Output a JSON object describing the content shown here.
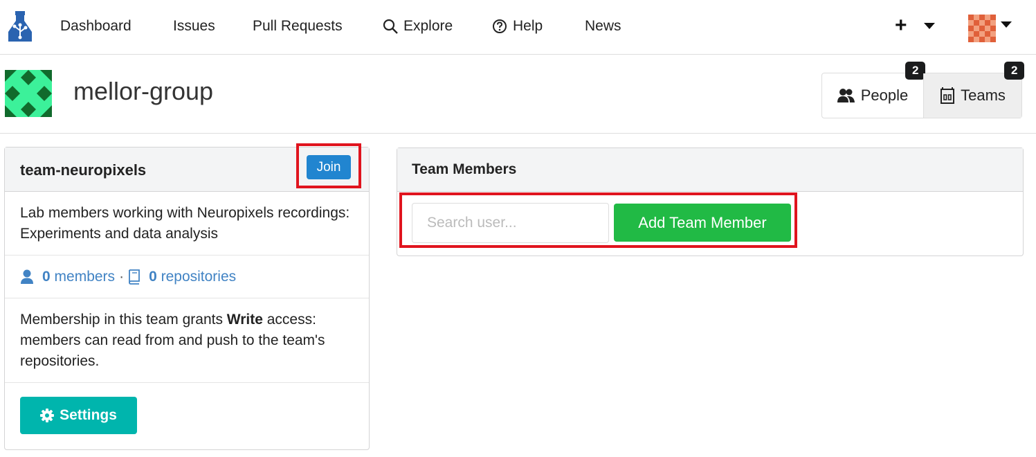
{
  "nav": {
    "items": [
      {
        "label": "Dashboard"
      },
      {
        "label": "Issues"
      },
      {
        "label": "Pull Requests"
      },
      {
        "label": "Explore",
        "icon": "search-icon"
      },
      {
        "label": "Help",
        "icon": "help-circle-icon"
      },
      {
        "label": "News"
      }
    ],
    "plus_label": "+"
  },
  "org": {
    "name": "mellor-group",
    "tabs": {
      "people": {
        "label": "People",
        "count": "2"
      },
      "teams": {
        "label": "Teams",
        "count": "2"
      }
    }
  },
  "team": {
    "name": "team-neuropixels",
    "join_label": "Join",
    "description": "Lab members working with Neuropixels recordings: Experiments and data analysis",
    "members_count": "0",
    "members_label": "members",
    "separator": "·",
    "repos_count": "0",
    "repos_label": "repositories",
    "permission": {
      "prefix": "Membership in this team grants ",
      "level": "Write",
      "suffix": " access: members can read from and push to the team's repositories."
    },
    "settings_label": "Settings"
  },
  "members_panel": {
    "title": "Team Members",
    "search_placeholder": "Search user...",
    "add_label": "Add Team Member"
  },
  "colors": {
    "join": "#2185d0",
    "settings": "#00b5ad",
    "add": "#21ba45",
    "highlight": "#e0141e",
    "link": "#4183c4"
  }
}
